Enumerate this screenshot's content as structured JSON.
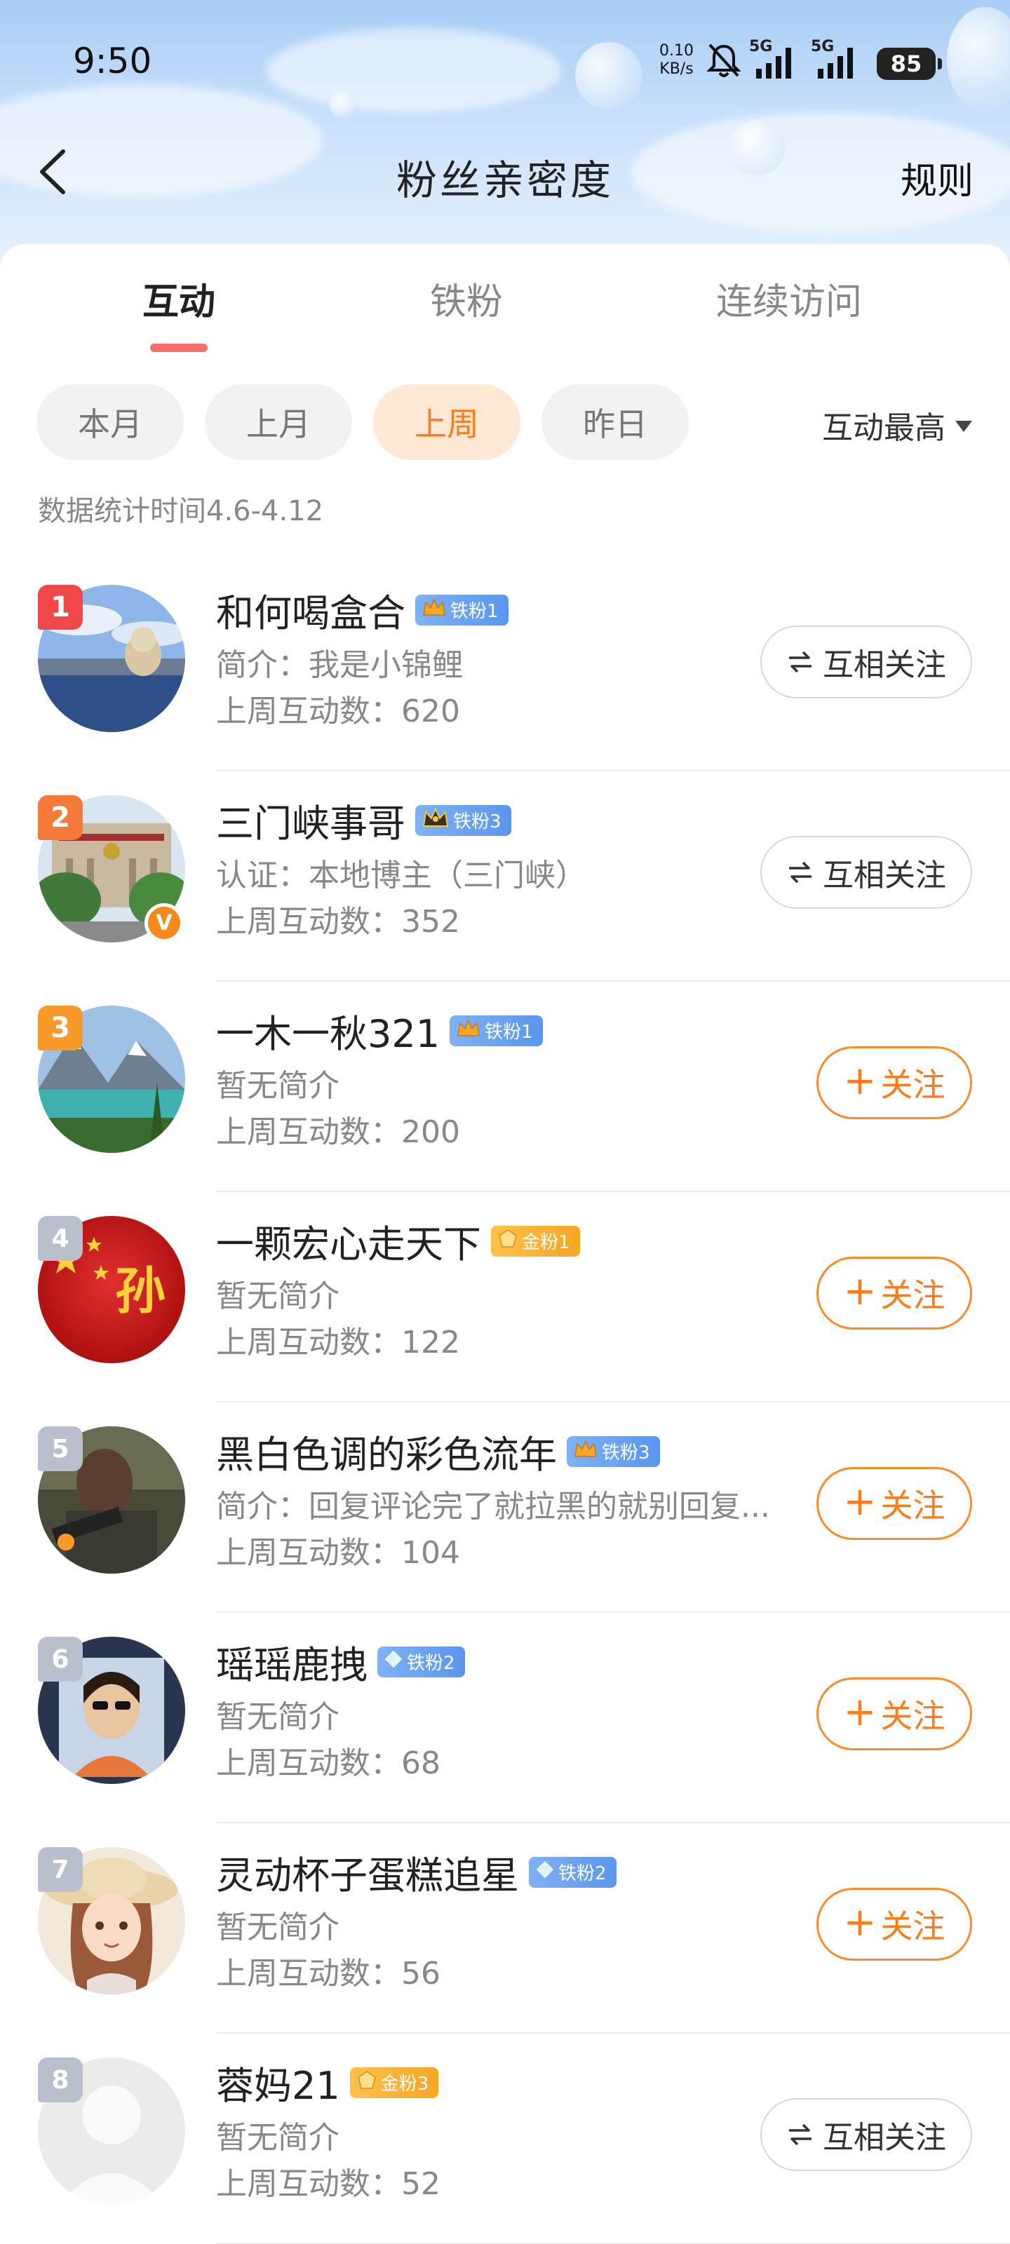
{
  "status_bar": {
    "time": "9:50",
    "net_speed_value": "0.10",
    "net_speed_unit": "KB/s",
    "signal1_label": "5G",
    "signal2_label": "5G",
    "battery": "85"
  },
  "header": {
    "title": "粉丝亲密度",
    "rules_label": "规则"
  },
  "tabs": [
    {
      "label": "互动",
      "active": true
    },
    {
      "label": "铁粉",
      "active": false
    },
    {
      "label": "连续访问",
      "active": false
    }
  ],
  "filters": [
    {
      "label": "本月",
      "active": false
    },
    {
      "label": "上月",
      "active": false
    },
    {
      "label": "上周",
      "active": true
    },
    {
      "label": "昨日",
      "active": false
    }
  ],
  "sort_label": "互动最高",
  "stat_range": "数据统计时间4.6-4.12",
  "colors": {
    "accent": "#ff7a1a",
    "tab_underline": "#f56f6c",
    "iron_badge": "#5a96ee",
    "gold_badge": "#f5a623"
  },
  "fans": [
    {
      "rank": "1",
      "name": "和何喝盒合",
      "badge": "铁粉1",
      "badge_type": "iron",
      "desc": "简介：我是小锦鲤",
      "count": "上周互动数：620",
      "action": "互相关注",
      "action_type": "mutual"
    },
    {
      "rank": "2",
      "name": "三门峡事哥",
      "badge": "铁粉3",
      "badge_type": "iron",
      "desc": "认证：本地博主（三门峡）",
      "count": "上周互动数：352",
      "action": "互相关注",
      "action_type": "mutual"
    },
    {
      "rank": "3",
      "name": "一木一秋321",
      "badge": "铁粉1",
      "badge_type": "iron",
      "desc": "暂无简介",
      "count": "上周互动数：200",
      "action": "关注",
      "action_type": "follow"
    },
    {
      "rank": "4",
      "name": "一颗宏心走天下",
      "badge": "金粉1",
      "badge_type": "gold",
      "desc": "暂无简介",
      "count": "上周互动数：122",
      "action": "关注",
      "action_type": "follow"
    },
    {
      "rank": "5",
      "name": "黑白色调的彩色流年",
      "badge": "铁粉3",
      "badge_type": "iron",
      "desc": "简介：回复评论完了就拉黑的就别回复...",
      "count": "上周互动数：104",
      "action": "关注",
      "action_type": "follow"
    },
    {
      "rank": "6",
      "name": "瑶瑶鹿拽",
      "badge": "铁粉2",
      "badge_type": "iron",
      "desc": "暂无简介",
      "count": "上周互动数：68",
      "action": "关注",
      "action_type": "follow"
    },
    {
      "rank": "7",
      "name": "灵动杯子蛋糕追星",
      "badge": "铁粉2",
      "badge_type": "iron",
      "desc": "暂无简介",
      "count": "上周互动数：56",
      "action": "关注",
      "action_type": "follow"
    },
    {
      "rank": "8",
      "name": "蓉妈21",
      "badge": "金粉3",
      "badge_type": "gold",
      "desc": "暂无简介",
      "count": "上周互动数：52",
      "action": "互相关注",
      "action_type": "mutual"
    }
  ],
  "avatar_text": {
    "4": "孙"
  }
}
